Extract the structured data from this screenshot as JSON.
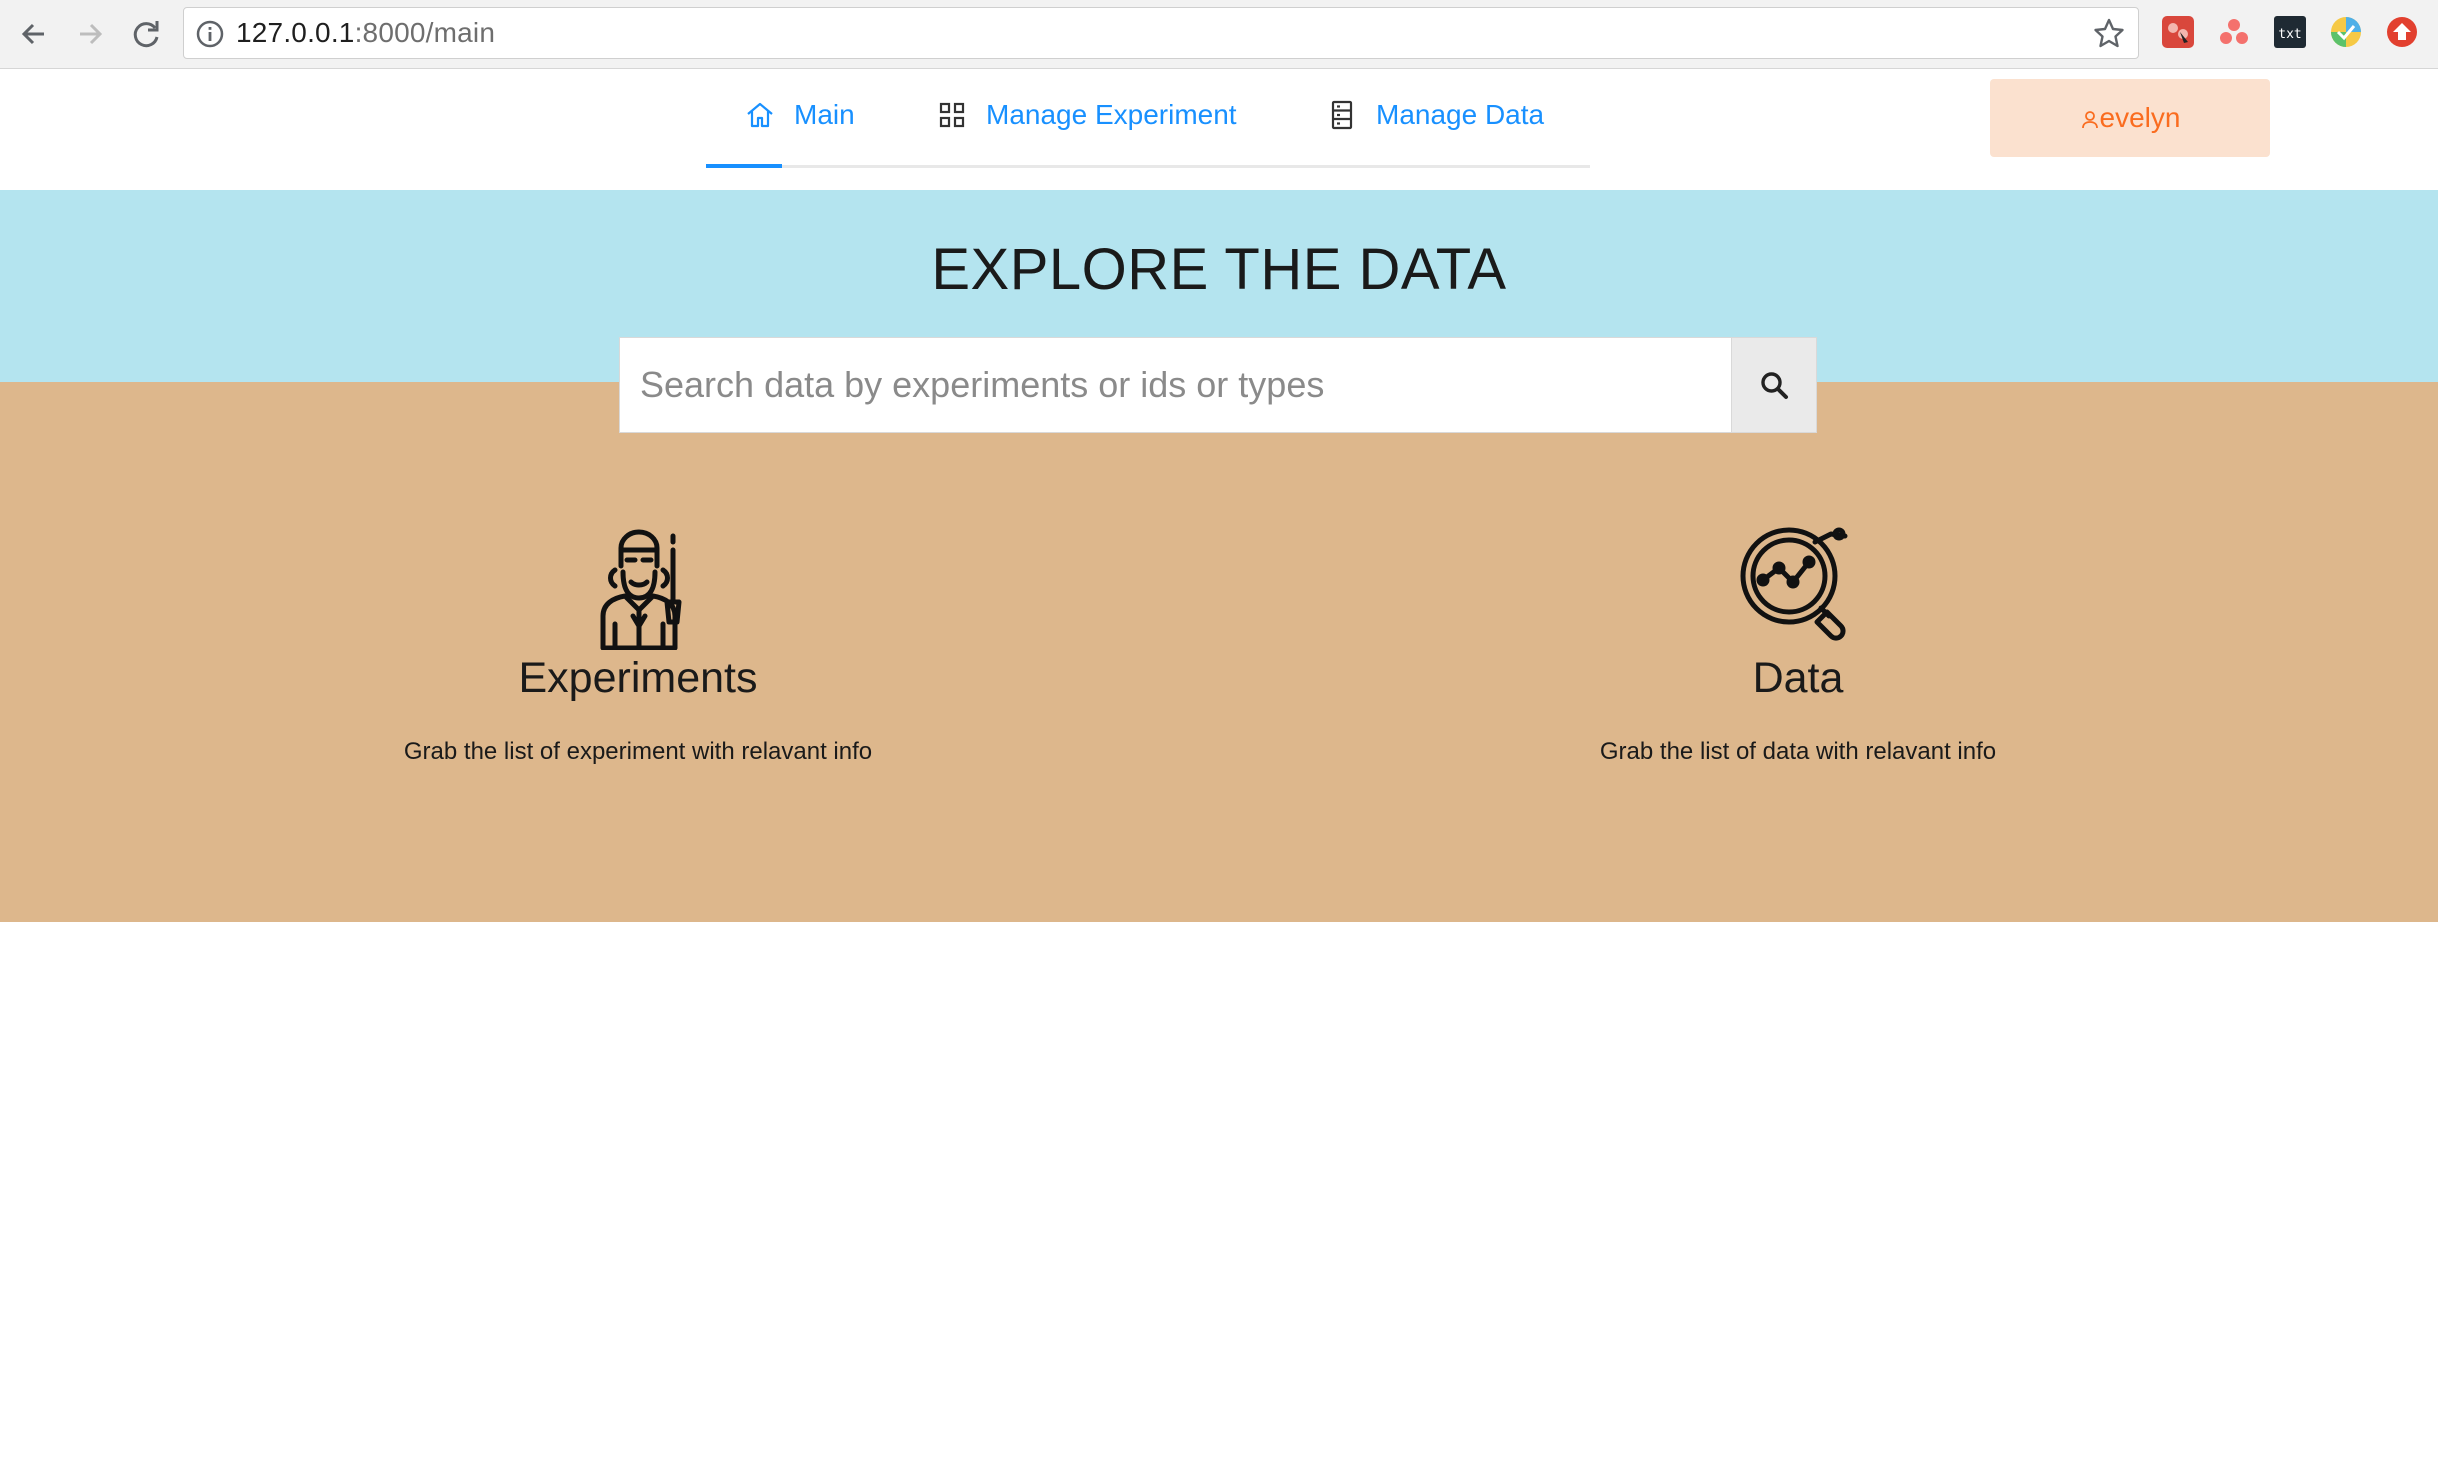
{
  "browser": {
    "url_host": "127.0.0.1",
    "url_rest": ":8000/main"
  },
  "nav": {
    "tabs": [
      {
        "label": "Main",
        "icon": "home-icon",
        "active": true
      },
      {
        "label": "Manage Experiment",
        "icon": "grid-icon",
        "active": false
      },
      {
        "label": "Manage Data",
        "icon": "database-icon",
        "active": false
      }
    ],
    "user": "evelyn"
  },
  "hero": {
    "title": "EXPLORE THE DATA",
    "search_placeholder": "Search data by experiments or ids or types"
  },
  "features": [
    {
      "title": "Experiments",
      "description": "Grab the list of experiment with relavant info",
      "icon": "scientist-icon"
    },
    {
      "title": "Data",
      "description": "Grab the list of data with relavant info",
      "icon": "data-analysis-icon"
    }
  ],
  "colors": {
    "accent": "#1890ff",
    "hero_blue": "#b4e4ef",
    "hero_tan": "#ddb78c",
    "user_bg": "#fbe1cf",
    "user_text": "#fa6c1f"
  }
}
